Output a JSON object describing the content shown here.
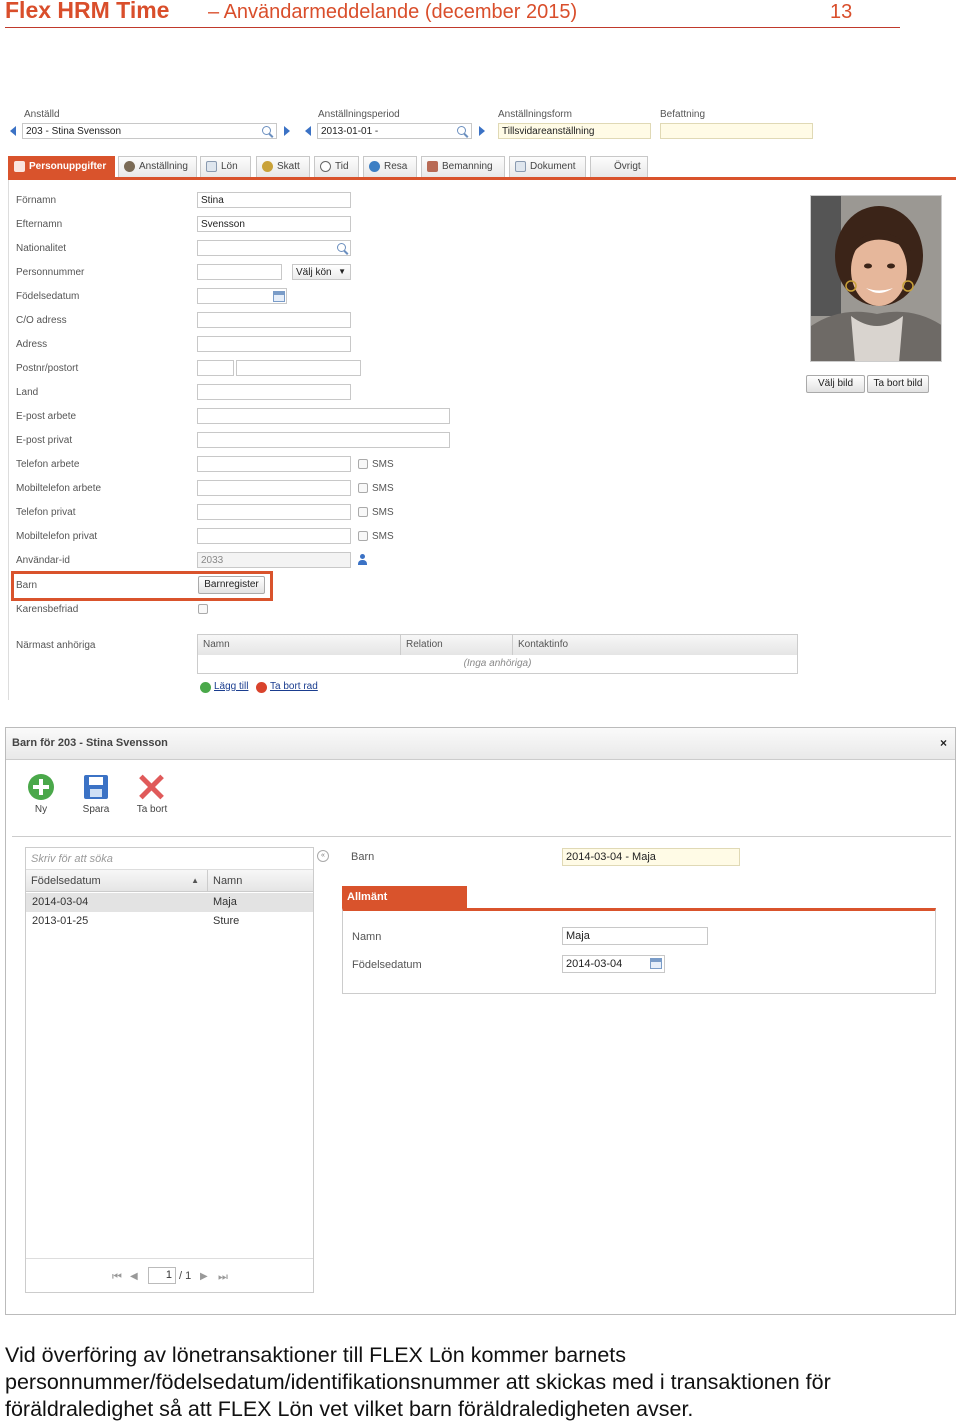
{
  "doc_header": {
    "brand": "Flex HRM Time",
    "subtitle": "– Användarmeddelande (december 2015)",
    "page": "13"
  },
  "top_fields": {
    "employee_label": "Anställd",
    "employee_value": "203 - Stina Svensson",
    "period_label": "Anställningsperiod",
    "period_value": "2013-01-01 -",
    "form_label": "Anställningsform",
    "form_value": "Tillsvidareanställning",
    "position_label": "Befattning",
    "position_value": ""
  },
  "tabs": [
    {
      "label": "Personuppgifter",
      "icon": "person-card-icon"
    },
    {
      "label": "Anställning",
      "icon": "person-icon"
    },
    {
      "label": "Lön",
      "icon": "document-icon"
    },
    {
      "label": "Skatt",
      "icon": "money-bag-icon"
    },
    {
      "label": "Tid",
      "icon": "clock-icon"
    },
    {
      "label": "Resa",
      "icon": "globe-icon"
    },
    {
      "label": "Bemanning",
      "icon": "staffing-icon"
    },
    {
      "label": "Dokument",
      "icon": "document-icon"
    },
    {
      "label": "Övrigt",
      "icon": ""
    }
  ],
  "form": {
    "fornamn_label": "Förnamn",
    "fornamn": "Stina",
    "efternamn_label": "Efternamn",
    "efternamn": "Svensson",
    "nationalitet_label": "Nationalitet",
    "personnummer_label": "Personnummer",
    "kon": "Välj kön",
    "fodelsedatum_label": "Födelsedatum",
    "co_label": "C/O adress",
    "adress_label": "Adress",
    "postnr_label": "Postnr/postort",
    "land_label": "Land",
    "epost_arbete_label": "E-post arbete",
    "epost_privat_label": "E-post privat",
    "tel_arbete_label": "Telefon arbete",
    "mobil_arbete_label": "Mobiltelefon arbete",
    "tel_privat_label": "Telefon privat",
    "mobil_privat_label": "Mobiltelefon privat",
    "sms": "SMS",
    "anvandarid_label": "Användar-id",
    "anvandarid": "2033",
    "barn_label": "Barn",
    "barn_button": "Barnregister",
    "karens_label": "Karensbefriad",
    "narmast_label": "Närmast anhöriga",
    "grid_cols": [
      "Namn",
      "Relation",
      "Kontaktinfo"
    ],
    "grid_empty": "(Inga anhöriga)",
    "add_link": "Lägg till",
    "remove_link": "Ta bort rad"
  },
  "photo": {
    "choose": "Välj bild",
    "remove": "Ta bort bild"
  },
  "dialog": {
    "title": "Barn för 203 - Stina Svensson",
    "close": "×",
    "toolbar": {
      "new": "Ny",
      "save": "Spara",
      "delete": "Ta bort"
    },
    "search_placeholder": "Skriv för att söka",
    "list_cols": [
      "Födelsedatum",
      "Namn"
    ],
    "rows": [
      {
        "date": "2014-03-04",
        "name": "Maja"
      },
      {
        "date": "2013-01-25",
        "name": "Sture"
      }
    ],
    "pager": {
      "current": "1",
      "total": "/ 1"
    },
    "barn_label": "Barn",
    "barn_value": "2014-03-04 - Maja",
    "tab": "Allmänt",
    "namn_label": "Namn",
    "namn": "Maja",
    "fodd_label": "Födelsedatum",
    "fodd": "2014-03-04"
  },
  "body_text": "Vid överföring av lönetransaktioner till FLEX Lön kommer barnets personnummer/födelsedatum/identifikationsnummer att skickas med i transaktionen för föräldraledighet så att FLEX Lön vet vilket barn föräldraledigheten avser.",
  "colors": {
    "accent": "#d9532c",
    "link": "#1a3d8f",
    "selected_row": "#e3e3e3"
  }
}
